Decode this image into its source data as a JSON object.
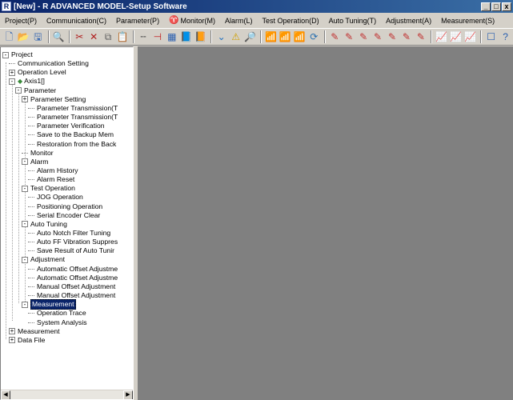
{
  "window": {
    "app_icon": "R",
    "title": "[New] - R ADVANCED MODEL-Setup Software",
    "minimize": "_",
    "restore": "□",
    "close": "x"
  },
  "menu": [
    {
      "label": "Project(P)"
    },
    {
      "label": "Communication(C)"
    },
    {
      "label": "Parameter(P)"
    },
    {
      "label": "Monitor(M)",
      "icon": "monitor-icon"
    },
    {
      "label": "Alarm(L)"
    },
    {
      "label": "Test Operation(D)"
    },
    {
      "label": "Auto Tuning(T)"
    },
    {
      "label": "Adjustment(A)"
    },
    {
      "label": "Measurement(S)"
    }
  ],
  "toolbar": {
    "icons": [
      "new-icon",
      "open-icon",
      "save-icon",
      "print-preview-icon",
      "cut-icon",
      "delete-icon",
      "copy-icon",
      "paste-icon",
      "line-icon",
      "arrow-icon",
      "table-icon",
      "book-icon",
      "book-arrow-icon",
      "filter-icon",
      "warning-icon",
      "search-icon",
      "signal-icon",
      "signal-2-icon",
      "signal-3-icon",
      "refresh-icon",
      "pen-icon",
      "pen-2-icon",
      "pen-3-icon",
      "pen-4-icon",
      "pen-5-icon",
      "pen-6-icon",
      "pen-7-icon",
      "chart-icon",
      "chart-2-icon",
      "chart-3-icon",
      "window-icon",
      "help-icon"
    ],
    "glyphs": [
      "🗋",
      "📂",
      "🖫",
      "🔍",
      "✂",
      "✕",
      "⧉",
      "📋",
      "╌",
      "⊣",
      "▦",
      "📘",
      "📙",
      "⌄",
      "⚠",
      "🔎",
      "📶",
      "📶",
      "📶",
      "⟳",
      "✎",
      "✎",
      "✎",
      "✎",
      "✎",
      "✎",
      "✎",
      "📈",
      "📈",
      "📈",
      "☐",
      "?"
    ]
  },
  "tree": {
    "nodes": [
      {
        "label": "Project",
        "exp": "-"
      },
      {
        "label": "Communication Setting"
      },
      {
        "label": "Operation Level",
        "exp": "+"
      },
      {
        "label": "Axis1[]",
        "exp": "-",
        "icon": "axis-icon"
      },
      {
        "label": "Parameter",
        "exp": "-"
      },
      {
        "label": "Parameter Setting",
        "exp": "+"
      },
      {
        "label": "Parameter Transmission(T"
      },
      {
        "label": "Parameter Transmission(T"
      },
      {
        "label": "Parameter Verification"
      },
      {
        "label": "Save to the Backup Mem"
      },
      {
        "label": "Restoration from the Back"
      },
      {
        "label": "Monitor"
      },
      {
        "label": "Alarm",
        "exp": "-"
      },
      {
        "label": "Alarm History"
      },
      {
        "label": "Alarm Reset"
      },
      {
        "label": "Test Operation",
        "exp": "-"
      },
      {
        "label": "JOG Operation"
      },
      {
        "label": "Positioning Operation"
      },
      {
        "label": "Serial Encoder Clear"
      },
      {
        "label": "Auto Tuning",
        "exp": "-"
      },
      {
        "label": "Auto Notch Filter Tuning"
      },
      {
        "label": "Auto FF Vibration Suppres"
      },
      {
        "label": "Save Result of Auto Tunir"
      },
      {
        "label": "Adjustment",
        "exp": "-"
      },
      {
        "label": "Automatic Offset Adjustme"
      },
      {
        "label": "Automatic Offset Adjustme"
      },
      {
        "label": "Manual Offset Adjustment"
      },
      {
        "label": "Manual Offset Adjustment"
      },
      {
        "label": "Measurement",
        "exp": "-",
        "selected": true
      },
      {
        "label": "Operation Trace"
      },
      {
        "label": "System Analysis"
      },
      {
        "label": "Measurement",
        "exp": "+"
      },
      {
        "label": "Data File",
        "exp": "+"
      }
    ],
    "scroll_left": "◀",
    "scroll_right": "▶"
  }
}
